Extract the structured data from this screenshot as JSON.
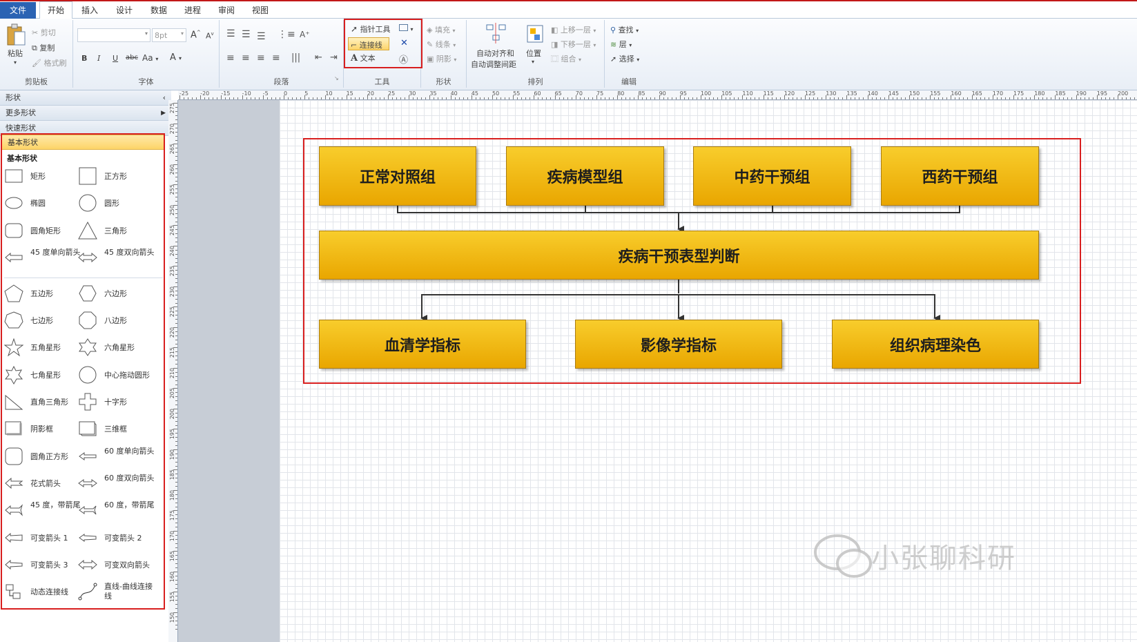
{
  "tabs": [
    "文件",
    "开始",
    "插入",
    "设计",
    "数据",
    "进程",
    "审阅",
    "视图"
  ],
  "ribbon": {
    "clipboard": {
      "title": "剪贴板",
      "paste": "粘贴",
      "cut": "剪切",
      "copy": "复制",
      "format_painter": "格式刷"
    },
    "font": {
      "title": "字体",
      "size": "8pt",
      "bold": "B",
      "italic": "I",
      "underline": "U",
      "strike": "abc",
      "case": "Aa",
      "color": "A",
      "grow": "A",
      "shrink": "A"
    },
    "paragraph": {
      "title": "段落"
    },
    "tools": {
      "title": "工具",
      "pointer": "指针工具",
      "connector": "连接线",
      "text": "文本"
    },
    "shape": {
      "title": "形状",
      "fill": "填充",
      "line": "线条",
      "shadow": "阴影"
    },
    "arrange": {
      "title": "排列",
      "auto_align": "自动对齐和",
      "auto_space": "自动调整间距",
      "position": "位置",
      "bring_forward": "上移一层",
      "send_backward": "下移一层",
      "group": "组合"
    },
    "editing": {
      "title": "编辑",
      "find": "查找",
      "layers": "层",
      "select": "选择"
    }
  },
  "shapes_pane": {
    "title": "形状",
    "more_shapes": "更多形状",
    "quick_shapes": "快速形状",
    "basic_shapes_header": "基本形状",
    "stencil_title": "基本形状",
    "items": [
      "矩形",
      "正方形",
      "椭圆",
      "圆形",
      "圆角矩形",
      "三角形",
      "45 度单向箭头",
      "45 度双向箭头",
      "五边形",
      "六边形",
      "七边形",
      "八边形",
      "五角星形",
      "六角星形",
      "七角星形",
      "中心拖动圆形",
      "直角三角形",
      "十字形",
      "阴影框",
      "三维框",
      "圆角正方形",
      "60 度单向箭头",
      "花式箭头",
      "60 度双向箭头",
      "45 度，带箭尾",
      "60 度，带箭尾",
      "可变箭头 1",
      "可变箭头 2",
      "可变箭头 3",
      "可变双向箭头",
      "动态连接线",
      "直线-曲线连接线"
    ]
  },
  "ruler": {
    "h": [
      "-25",
      "-20",
      "-15",
      "-10",
      "-5",
      "0",
      "5",
      "10",
      "15",
      "20",
      "25",
      "30",
      "35",
      "40",
      "45",
      "50",
      "55",
      "60",
      "65",
      "70",
      "75",
      "80",
      "85",
      "90",
      "95",
      "100",
      "105",
      "110",
      "115",
      "120",
      "125",
      "130",
      "135",
      "140",
      "145",
      "150",
      "155",
      "160",
      "165",
      "170",
      "175",
      "180",
      "185",
      "190",
      "195",
      "200"
    ],
    "v": [
      "275",
      "270",
      "265",
      "260",
      "255",
      "250",
      "245",
      "240",
      "235",
      "230",
      "225",
      "220",
      "215",
      "210",
      "205",
      "200",
      "195",
      "190",
      "185",
      "180",
      "175",
      "170",
      "165",
      "160",
      "155",
      "150"
    ]
  },
  "diagram": {
    "groups": [
      "正常对照组",
      "疾病模型组",
      "中药干预组",
      "西药干预组"
    ],
    "center": "疾病干预表型判断",
    "outputs": [
      "血清学指标",
      "影像学指标",
      "组织病理染色"
    ]
  },
  "watermark": "小张聊科研",
  "colors": {
    "box_top": "#f8cd2c",
    "box_bottom": "#e9a600",
    "highlight": "#d81e1e",
    "file_tab": "#2b63b3"
  }
}
